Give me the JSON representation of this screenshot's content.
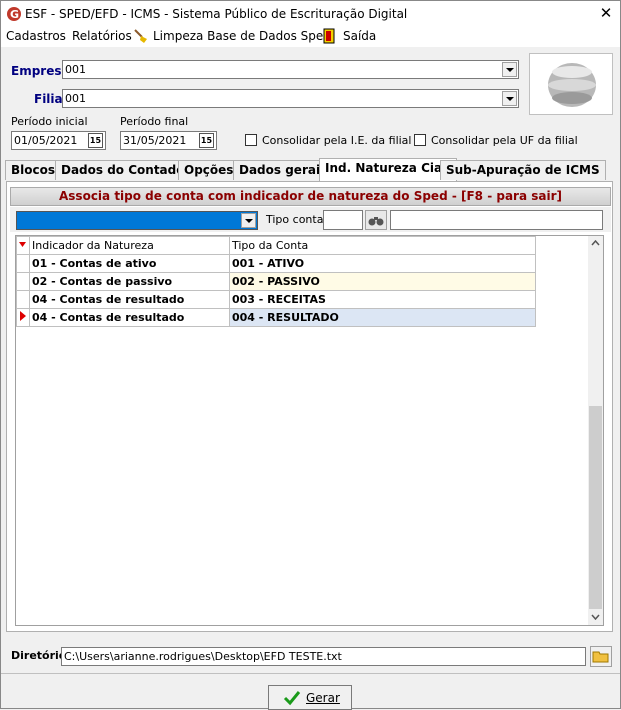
{
  "window": {
    "title": "ESF - SPED/EFD - ICMS - Sistema Público de Escrituração Digital",
    "close": "✕"
  },
  "menu": {
    "cadastros": "Cadastros",
    "relatorios": "Relatórios",
    "limpeza": "Limpeza Base de Dados Sped",
    "saida": "Saída"
  },
  "form": {
    "empresa_label": "Empresa",
    "empresa_value": "001",
    "filial_label": "Filial",
    "filial_value": "001",
    "periodo_inicial_label": "Período inicial",
    "periodo_inicial_value": "01/05/2021",
    "periodo_final_label": "Período final",
    "periodo_final_value": "31/05/2021",
    "calendar_glyph": "15",
    "consolidar_ie": "Consolidar pela I.E. da filial",
    "consolidar_uf": "Consolidar pela UF da filial"
  },
  "tabs": [
    "Blocos",
    "Dados do Contador",
    "Opções",
    "Dados gerais",
    "Ind. Natureza Ciap",
    "Sub-Apuração de ICMS"
  ],
  "panel": {
    "header": "Associa tipo de conta com indicador de natureza do Sped - [F8 - para sair]",
    "tipo_conta_label": "Tipo conta",
    "tipo_conta_value": "",
    "search_value": "",
    "columns": [
      "Indicador da Natureza",
      "Tipo da Conta"
    ],
    "rows": [
      [
        "01 - Contas de ativo",
        "001 - ATIVO"
      ],
      [
        "02 - Contas de passivo",
        "002 - PASSIVO"
      ],
      [
        "04 - Contas de resultado",
        "003 - RECEITAS"
      ],
      [
        "04 - Contas de resultado",
        "004 - RESULTADO"
      ]
    ]
  },
  "diretorio": {
    "label": "Diretório",
    "value": "C:\\Users\\arianne.rodrigues\\Desktop\\EFD TESTE.txt"
  },
  "gerar_label": "Gerar",
  "colors": {
    "accent_blue": "#0078d7",
    "header_red": "#8b0000",
    "label_navy": "#000080",
    "row_selected": "#dce6f4",
    "row_highlight": "#fffbe6"
  }
}
